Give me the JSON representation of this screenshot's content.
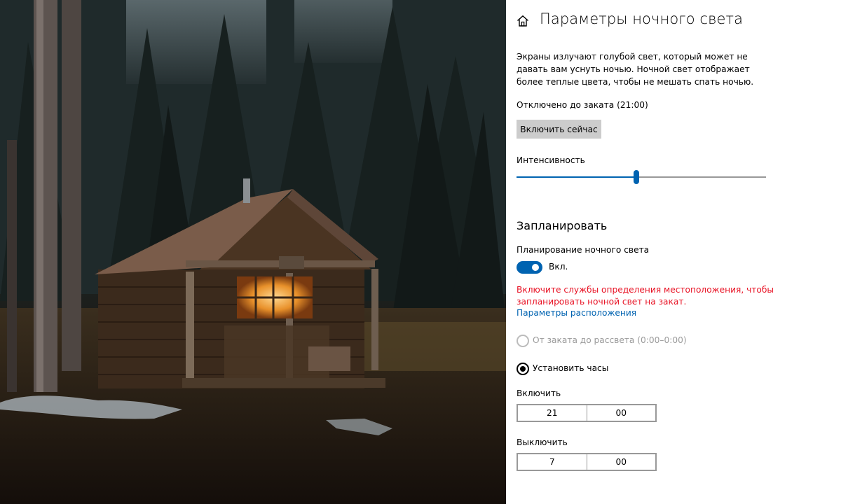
{
  "settings": {
    "title": "Параметры ночного света",
    "description": "Экраны излучают голубой свет, который может не давать вам уснуть ночью. Ночной свет отображает более теплые цвета, чтобы не мешать спать ночью.",
    "status": "Отключено до заката (21:00)",
    "enable_now_label": "Включить сейчас",
    "intensity_label": "Интенсивность",
    "intensity_value": 0.48,
    "schedule_heading": "Запланировать",
    "schedule_label": "Планирование ночного света",
    "schedule_toggle_state": "Вкл.",
    "schedule_on": true,
    "location_warning": "Включите службы определения местоположения, чтобы запланировать ночной свет на закат.",
    "location_link": "Параметры расположения",
    "radio_sunset": "От заката до рассвета (0:00–0:00)",
    "radio_sunset_disabled": true,
    "radio_set_hours": "Установить часы",
    "radio_set_hours_selected": true,
    "turn_on_label": "Включить",
    "turn_on_hour": "21",
    "turn_on_minute": "00",
    "turn_off_label": "Выключить",
    "turn_off_hour": "7",
    "turn_off_minute": "00"
  },
  "colors": {
    "accent": "#0063b1",
    "warning": "#e81123",
    "button_bg": "#cccccc"
  },
  "icons": {
    "home": "home-icon"
  }
}
